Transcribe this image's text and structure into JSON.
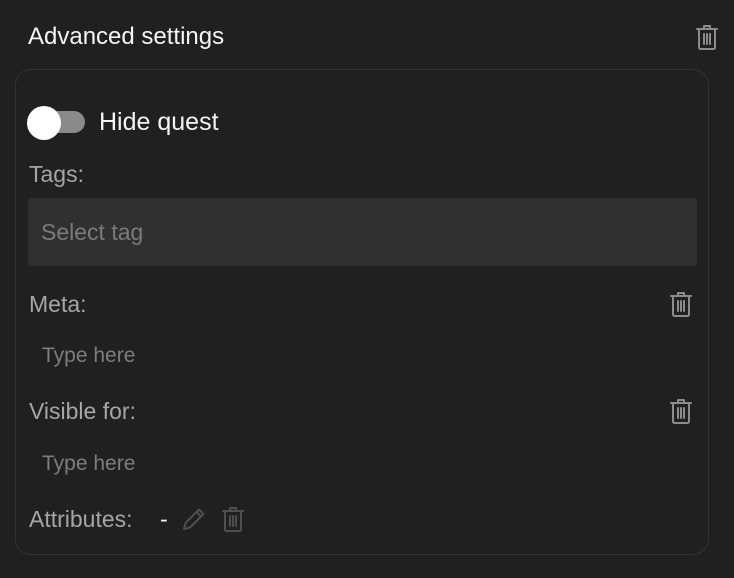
{
  "header": {
    "title": "Advanced settings",
    "delete_icon": "trash-icon"
  },
  "hide_quest": {
    "label": "Hide quest",
    "enabled": false
  },
  "tags": {
    "label": "Tags:",
    "placeholder": "Select tag"
  },
  "meta": {
    "label": "Meta:",
    "placeholder": "Type here",
    "value": ""
  },
  "visible_for": {
    "label": "Visible for:",
    "placeholder": "Type here",
    "value": ""
  },
  "attributes": {
    "label": "Attributes:",
    "value": "-",
    "edit_icon": "pencil-icon",
    "delete_icon": "trash-icon"
  },
  "colors": {
    "background": "#202020",
    "field_background": "#303030",
    "label": "#a6a6a6",
    "text": "#f5f5f5",
    "toggle_track_off": "#8a8a8a"
  }
}
